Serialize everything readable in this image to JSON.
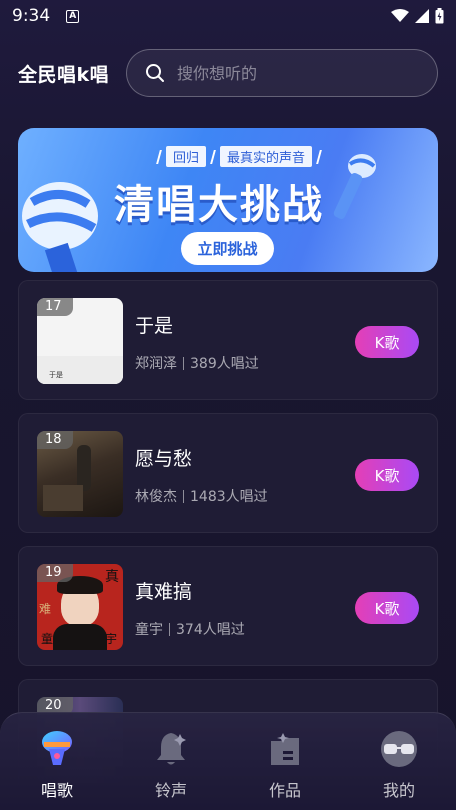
{
  "status_bar": {
    "time": "9:34",
    "a_icon": "A"
  },
  "header": {
    "app_title": "全民唱k唱",
    "search_placeholder": "搜你想听的"
  },
  "banner": {
    "tag_left": "回归",
    "tag_right": "最真实的声音",
    "headline": "清唱大挑战",
    "cta": "立即挑战"
  },
  "songs": [
    {
      "rank": "17",
      "title": "于是",
      "artist": "郑润泽",
      "singers": "389人唱过",
      "button": "K歌",
      "cover_text": "于是"
    },
    {
      "rank": "18",
      "title": "愿与愁",
      "artist": "林俊杰",
      "singers": "1483人唱过",
      "button": "K歌"
    },
    {
      "rank": "19",
      "title": "真难搞",
      "artist": "童宇",
      "singers": "374人唱过",
      "button": "K歌",
      "cover_text": [
        "真",
        "难",
        "宇",
        "童"
      ]
    },
    {
      "rank": "20"
    }
  ],
  "bottom_nav": [
    {
      "label": "唱歌",
      "icon": "microphone-icon",
      "active": true
    },
    {
      "label": "铃声",
      "icon": "bell-icon",
      "active": false
    },
    {
      "label": "作品",
      "icon": "folder-icon",
      "active": false
    },
    {
      "label": "我的",
      "icon": "glasses-icon",
      "active": false
    }
  ]
}
